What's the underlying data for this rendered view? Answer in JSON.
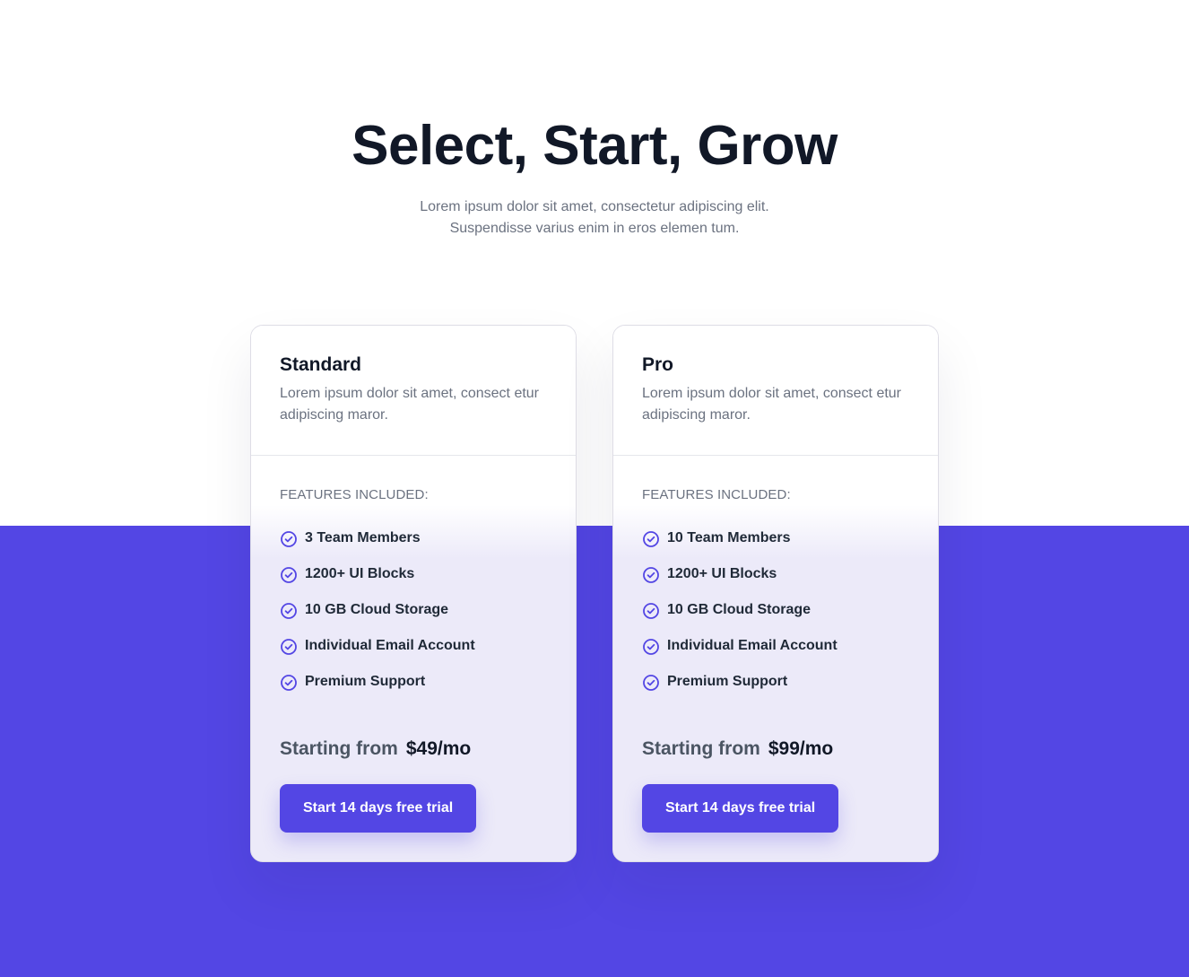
{
  "hero": {
    "title": "Select, Start, Grow",
    "subtitle_line1": "Lorem ipsum dolor sit amet, consectetur adipiscing elit.",
    "subtitle_line2": "Suspendisse varius enim in eros elemen tum."
  },
  "colors": {
    "accent": "#5346e4",
    "heading": "#111827",
    "muted_text": "#6b7280",
    "card_lower_bg": "#eceaf9"
  },
  "plans": [
    {
      "name": "Standard",
      "description": "Lorem ipsum dolor sit amet, consect etur adipiscing maror.",
      "features_title": "FEATURES INCLUDED:",
      "features": [
        "3 Team Members",
        "1200+ UI Blocks",
        "10 GB Cloud Storage",
        "Individual Email Account",
        "Premium Support"
      ],
      "price_prefix": "Starting from",
      "price": "$49/mo",
      "cta_label": "Start 14 days free trial"
    },
    {
      "name": "Pro",
      "description": "Lorem ipsum dolor sit amet, consect etur adipiscing maror.",
      "features_title": "FEATURES INCLUDED:",
      "features": [
        "10 Team Members",
        "1200+ UI Blocks",
        "10 GB Cloud Storage",
        "Individual Email Account",
        "Premium Support"
      ],
      "price_prefix": "Starting from",
      "price": "$99/mo",
      "cta_label": "Start 14 days free trial"
    }
  ],
  "icons": {
    "feature_check": "check-circle-icon"
  }
}
